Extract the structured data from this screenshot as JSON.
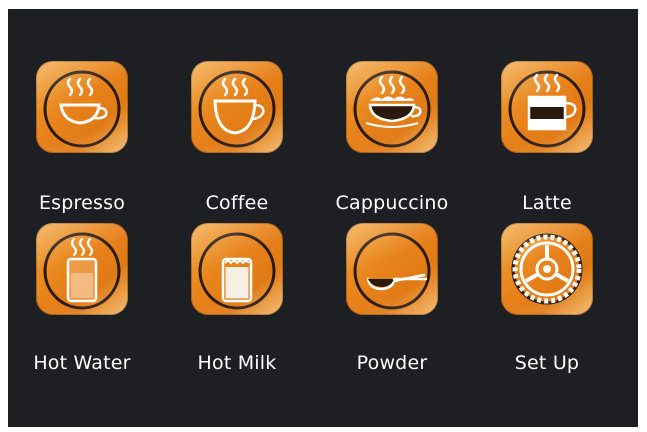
{
  "buttons": [
    {
      "label": "Espresso",
      "icon": "espresso-cup-icon"
    },
    {
      "label": "Coffee",
      "icon": "coffee-cup-icon"
    },
    {
      "label": "Cappuccino",
      "icon": "cappuccino-cup-icon"
    },
    {
      "label": "Latte",
      "icon": "latte-glass-icon"
    },
    {
      "label": "Hot Water",
      "icon": "hot-water-glass-icon"
    },
    {
      "label": "Hot Milk",
      "icon": "hot-milk-glass-icon"
    },
    {
      "label": "Powder",
      "icon": "powder-spoon-icon"
    },
    {
      "label": "Set Up",
      "icon": "gear-icon"
    }
  ],
  "colors": {
    "background": "#1e1f23",
    "tile_orange": "#e8821a",
    "icon_dark": "#2a1a0e",
    "icon_light": "#ffffff"
  }
}
